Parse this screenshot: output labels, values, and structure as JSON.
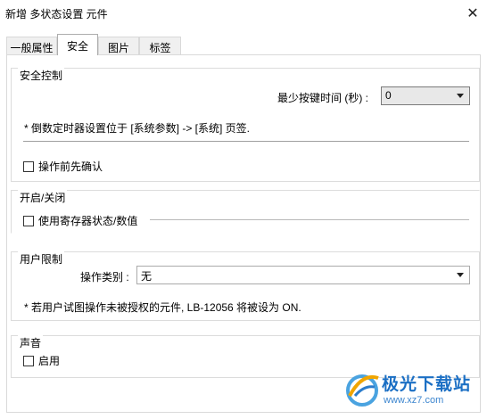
{
  "window": {
    "title": "新增 多状态设置 元件",
    "close_glyph": "✕"
  },
  "tabs": [
    {
      "label": "一般属性",
      "active": false
    },
    {
      "label": "安全",
      "active": true
    },
    {
      "label": "图片",
      "active": false
    },
    {
      "label": "标签",
      "active": false
    }
  ],
  "security_control": {
    "title": "安全控制",
    "min_press_label": "最少按键时间 (秒) :",
    "min_press_value": "0",
    "note": "* 倒数定时器设置位于 [系统参数] -> [系统] 页签.",
    "confirm_label": "操作前先确认"
  },
  "on_off": {
    "title": "开启/关闭",
    "register_label": "使用寄存器状态/数值"
  },
  "user_restriction": {
    "title": "用户限制",
    "op_type_label": "操作类别 :",
    "op_type_value": "无",
    "note": "* 若用户试图操作未被授权的元件, LB-12056 将被设为 ON."
  },
  "sound": {
    "title": "声音",
    "enable_label": "启用"
  },
  "watermark": {
    "name": "极光下载站",
    "url": "www.xz7.com"
  }
}
